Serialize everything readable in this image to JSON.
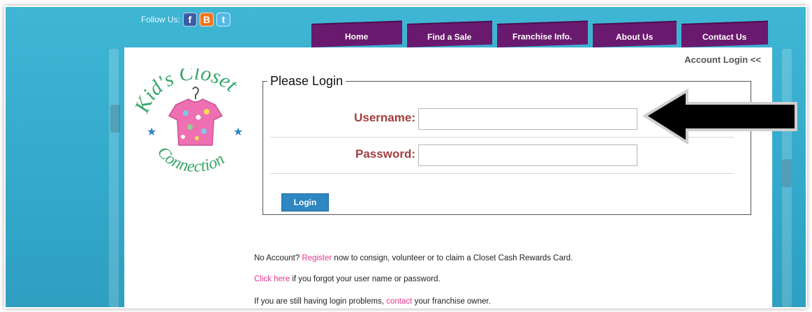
{
  "header": {
    "follow_label": "Follow Us:",
    "social": [
      {
        "icon": "facebook-icon",
        "glyph": "f",
        "color": "#3b5da8"
      },
      {
        "icon": "blogger-icon",
        "glyph": "B",
        "color": "#f27418"
      },
      {
        "icon": "twitter-icon",
        "glyph": "t",
        "color": "#55b9e6"
      }
    ]
  },
  "nav": {
    "tabs": [
      {
        "label": "Home"
      },
      {
        "label": "Find a Sale"
      },
      {
        "label": "Franchise Info."
      },
      {
        "label": "About Us"
      },
      {
        "label": "Contact Us"
      }
    ],
    "color": "#6a1a6e"
  },
  "account_login": "Account Login <<",
  "logo": {
    "top_text": "Kid's Closet",
    "bottom_text": "Connection"
  },
  "login_form": {
    "legend": "Please Login",
    "username_label": "Username:",
    "username_value": "",
    "password_label": "Password:",
    "password_value": "",
    "button_label": "Login"
  },
  "info": {
    "line1": {
      "before": "No Account? ",
      "link": "Register",
      "after": " now to consign, volunteer or to claim a Closet Cash Rewards Card."
    },
    "line2": {
      "link": "Click here",
      "after": " if you forgot your user name or password."
    },
    "line3": {
      "before": "If you are still having login problems, ",
      "link": "contact",
      "after": " your franchise owner."
    }
  },
  "colors": {
    "background": "#3fb6d4",
    "label": "#a33d3d",
    "link": "#e8368f",
    "button": "#2e86c2"
  }
}
